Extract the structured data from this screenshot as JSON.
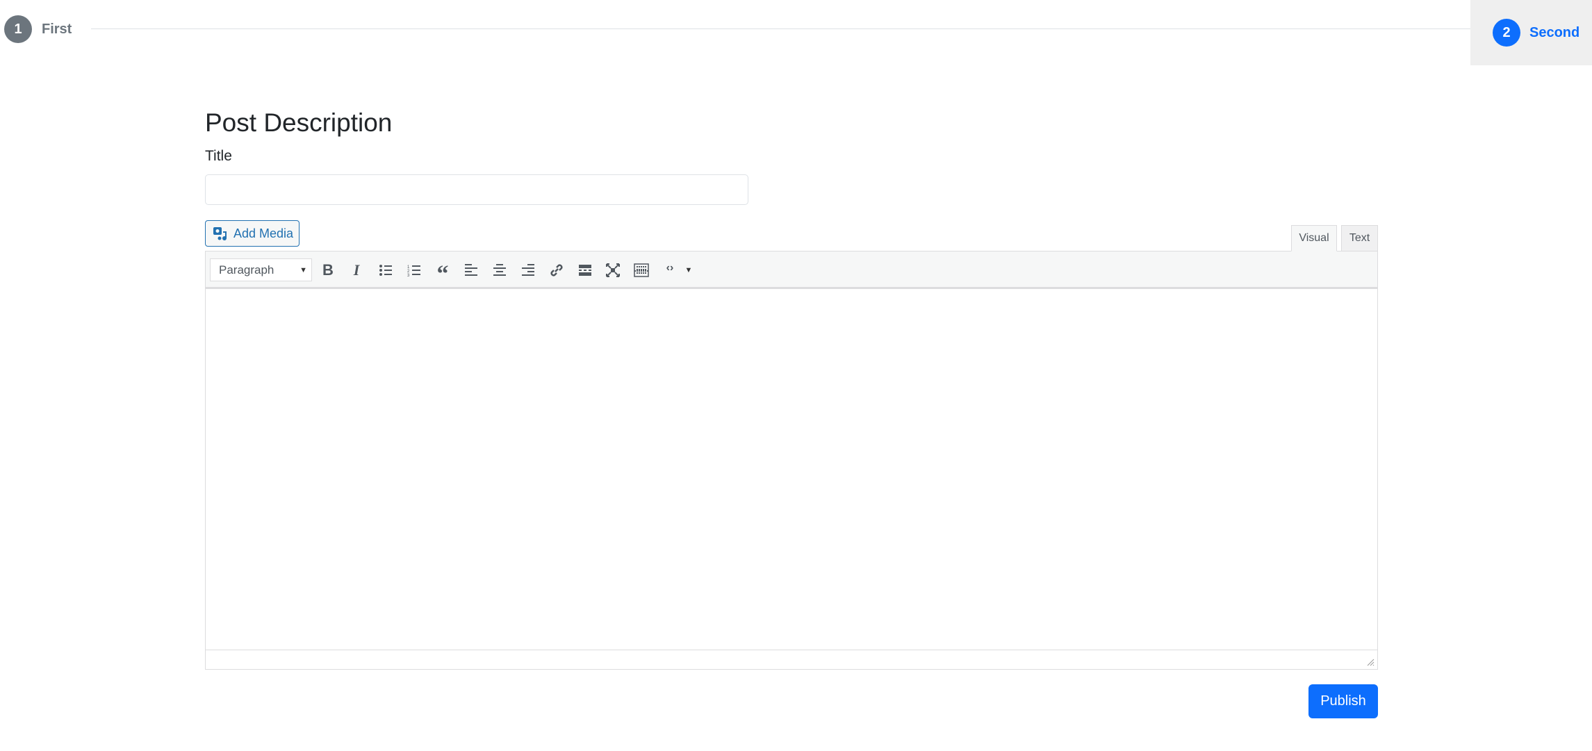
{
  "stepper": {
    "steps": [
      {
        "number": "1",
        "label": "First",
        "state": "inactive"
      },
      {
        "number": "2",
        "label": "Second",
        "state": "active"
      }
    ],
    "colors": {
      "inactive": "#6c757d",
      "active": "#0d6efd",
      "active_bg": "#efefef"
    }
  },
  "form": {
    "heading": "Post Description",
    "title_label": "Title",
    "title_value": "",
    "add_media_label": "Add Media",
    "tabs": [
      {
        "label": "Visual",
        "active": true
      },
      {
        "label": "Text",
        "active": false
      }
    ],
    "format_select": "Paragraph",
    "toolbar_icons": [
      "bold-icon",
      "italic-icon",
      "bulleted-list-icon",
      "numbered-list-icon",
      "blockquote-icon",
      "align-left-icon",
      "align-center-icon",
      "align-right-icon",
      "link-icon",
      "read-more-icon",
      "fullscreen-icon",
      "keyboard-icon",
      "code-icon",
      "dropdown-caret-icon"
    ],
    "content": "",
    "publish_label": "Publish"
  }
}
